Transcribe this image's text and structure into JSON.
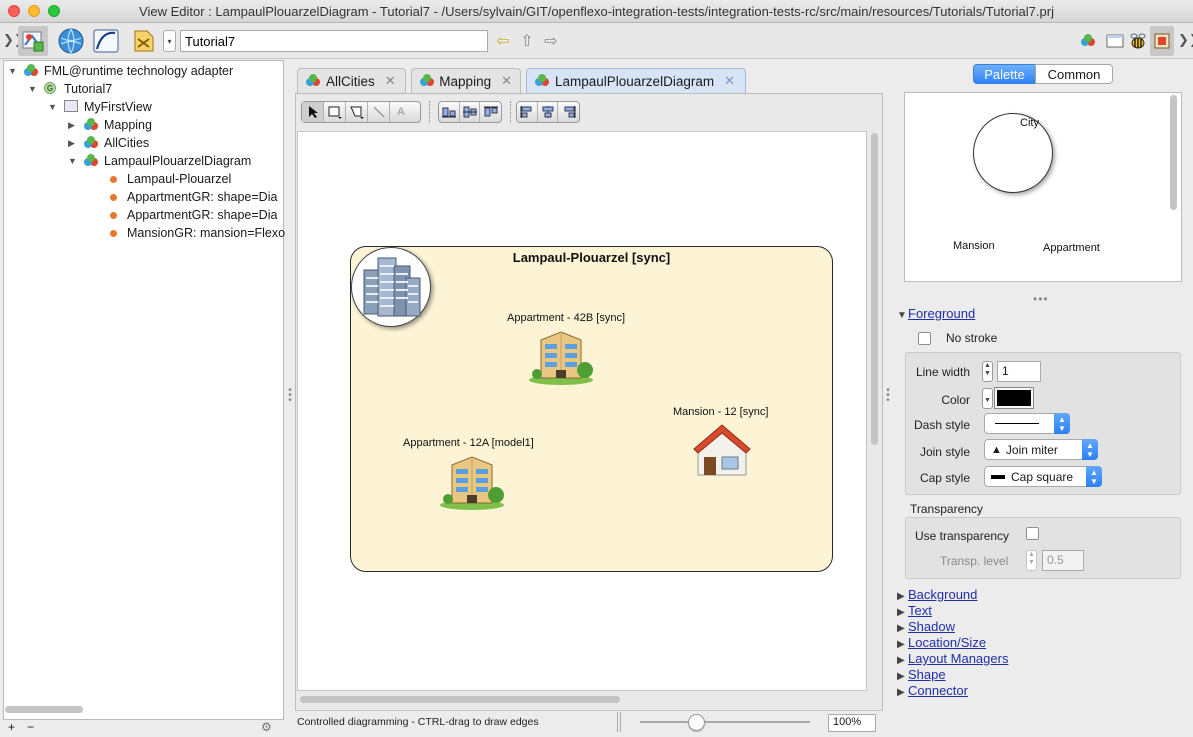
{
  "window": {
    "title": "View Editor : LampaulPlouarzelDiagram - Tutorial7 - /Users/sylvain/GIT/openflexo-integration-tests/integration-tests-rc/src/main/resources/Tutorials/Tutorial7.prj"
  },
  "toolbar": {
    "project_value": "Tutorial7",
    "left_icons": [
      "view-editor-icon",
      "globe-icon",
      "curve-tool-icon",
      "plugin-icon"
    ],
    "right_icons": [
      "fml-icon",
      "window-icon",
      "bee-icon",
      "inspector-icon"
    ]
  },
  "tree": {
    "items": [
      {
        "label": "FML@runtime technology adapter",
        "expanded": true,
        "icon": "fml-icon"
      },
      {
        "label": "Tutorial7",
        "expanded": true,
        "icon": "project-icon"
      },
      {
        "label": "MyFirstView",
        "expanded": true,
        "icon": "view-icon"
      },
      {
        "label": "Mapping",
        "expanded": false,
        "icon": "fml-icon"
      },
      {
        "label": "AllCities",
        "expanded": false,
        "icon": "fml-icon"
      },
      {
        "label": "LampaulPlouarzelDiagram",
        "expanded": true,
        "icon": "fml-icon"
      },
      {
        "label": "Lampaul-Plouarzel",
        "icon": "instance-dot-icon"
      },
      {
        "label": "AppartmentGR: shape=Dia",
        "icon": "instance-dot-icon"
      },
      {
        "label": "AppartmentGR: shape=Dia",
        "icon": "instance-dot-icon"
      },
      {
        "label": "MansionGR: mansion=Flexo",
        "icon": "instance-dot-icon"
      }
    ],
    "footer": {
      "add": "+",
      "remove": "−",
      "settings": "⚙"
    }
  },
  "tabs": [
    {
      "label": "AllCities",
      "active": false
    },
    {
      "label": "Mapping",
      "active": false
    },
    {
      "label": "LampaulPlouarzelDiagram",
      "active": true
    }
  ],
  "diagram": {
    "city_label": "Lampaul-Plouarzel [sync]",
    "shapes": [
      {
        "label": "Appartment -  42B [sync]",
        "icon": "apartment-building-icon"
      },
      {
        "label": "Appartment -  12A [model1]",
        "icon": "apartment-building-icon"
      },
      {
        "label": "Mansion - 12 [sync]",
        "icon": "house-icon"
      }
    ]
  },
  "status": {
    "text": "Controlled diagramming - CTRL-drag to draw edges",
    "zoom": "100%",
    "zoom_slider_fraction": 0.33
  },
  "right_panel": {
    "segments": {
      "palette": "Palette",
      "common": "Common",
      "selected": "Palette"
    },
    "palette_items": {
      "city": "City",
      "mansion": "Mansion",
      "appartment": "Appartment"
    },
    "foreground": {
      "title": "Foreground",
      "no_stroke_label": "No stroke",
      "line_width_label": "Line width",
      "line_width_value": "1",
      "color_label": "Color",
      "color_value": "#000000",
      "dash_style_label": "Dash style",
      "join_style_label": "Join style",
      "join_style_value": "Join miter",
      "cap_style_label": "Cap style",
      "cap_style_value": "Cap square"
    },
    "transparency": {
      "title": "Transparency",
      "use_label": "Use transparency",
      "level_label": "Transp. level",
      "level_value": "0.5"
    },
    "sections": [
      "Background",
      "Text",
      "Shadow",
      "Location/Size",
      "Layout Managers",
      "Shape",
      "Connector"
    ]
  },
  "colors": {
    "city_fill": "#fcf4d5",
    "active_tab": "#d7e4f5",
    "accent": "#2e84f5",
    "link": "#1f2fa8"
  }
}
